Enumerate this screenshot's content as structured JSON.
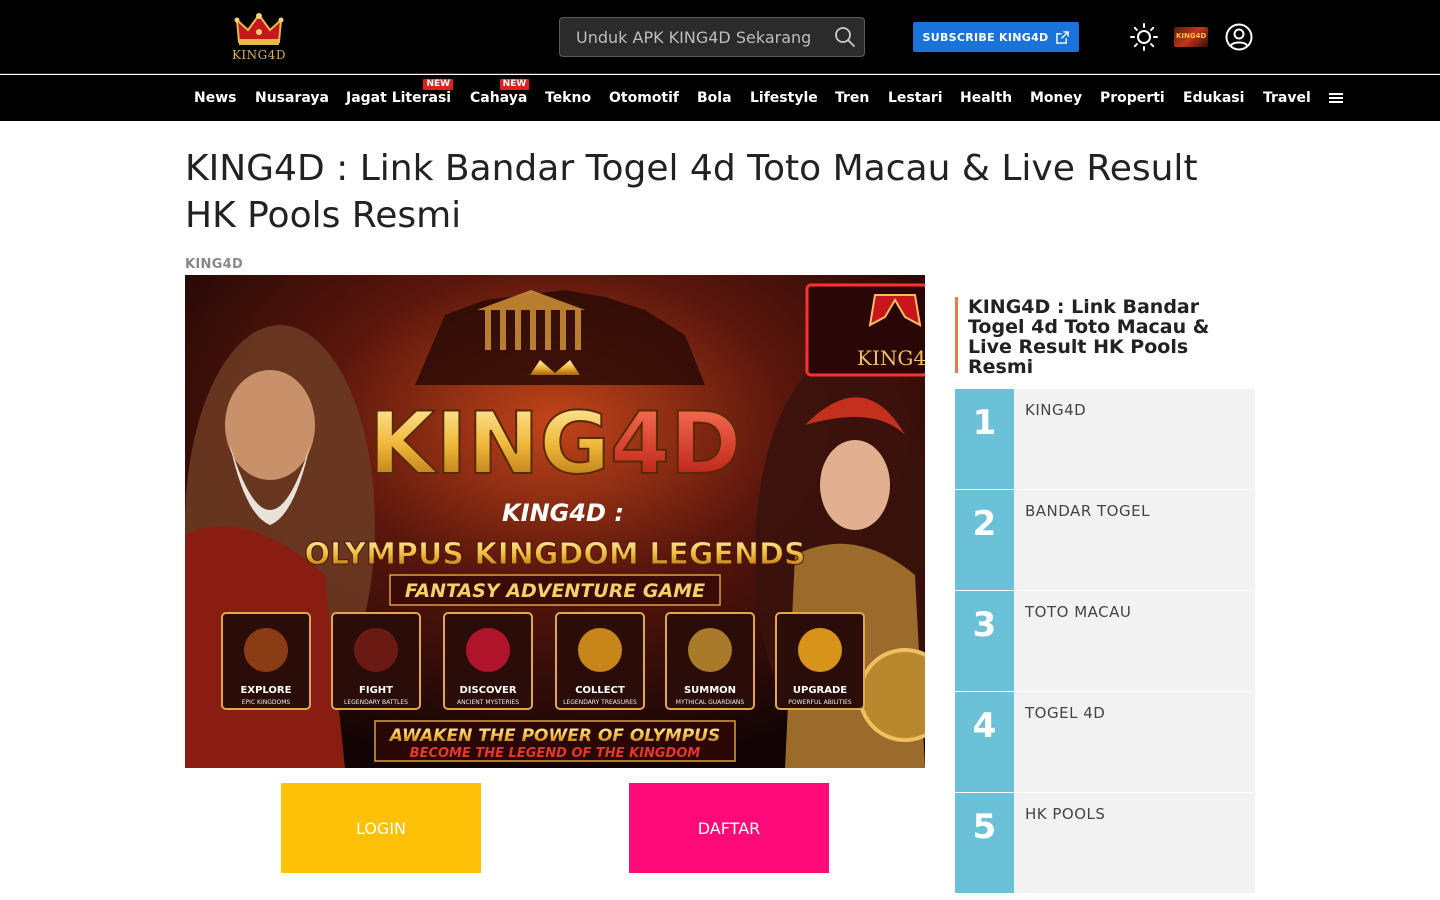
{
  "header": {
    "logo_text": "KING4D",
    "search_placeholder": "Unduk APK KING4D Sekarang",
    "subscribe_label": "SUBSCRIBE KING4D"
  },
  "nav": {
    "items": [
      {
        "label": "News"
      },
      {
        "label": "Nusaraya"
      },
      {
        "label": "Jagat Literasi",
        "badge": "NEW"
      },
      {
        "label": "Cahaya",
        "badge": "NEW"
      },
      {
        "label": "Tekno"
      },
      {
        "label": "Otomotif"
      },
      {
        "label": "Bola"
      },
      {
        "label": "Lifestyle"
      },
      {
        "label": "Tren"
      },
      {
        "label": "Lestari"
      },
      {
        "label": "Health"
      },
      {
        "label": "Money"
      },
      {
        "label": "Properti"
      },
      {
        "label": "Edukasi"
      },
      {
        "label": "Travel"
      }
    ]
  },
  "article": {
    "title": "KING4D : Link Bandar Togel 4d Toto Macau & Live Result HK Pools Resmi",
    "author": "KING4D",
    "banner": {
      "logo": "KING4D",
      "subtitle": "KING4D :",
      "headline": "OLYMPUS KINGDOM LEGENDS",
      "tagline": "FANTASY ADVENTURE GAME",
      "cards": [
        {
          "title": "EXPLORE",
          "sub": "EPIC KINGDOMS"
        },
        {
          "title": "FIGHT",
          "sub": "LEGENDARY BATTLES"
        },
        {
          "title": "DISCOVER",
          "sub": "ANCIENT MYSTERIES"
        },
        {
          "title": "COLLECT",
          "sub": "LEGENDARY TREASURES"
        },
        {
          "title": "SUMMON",
          "sub": "MYTHICAL GUARDIANS"
        },
        {
          "title": "UPGRADE",
          "sub": "POWERFUL ABILITIES"
        }
      ],
      "footer_line1": "AWAKEN THE POWER OF OLYMPUS",
      "footer_line2": "BECOME THE LEGEND OF THE KINGDOM"
    },
    "login_label": "LOGIN",
    "daftar_label": "DAFTAR"
  },
  "sidebar": {
    "heading": "KING4D : Link Bandar Togel 4d Toto Macau & Live Result HK Pools Resmi",
    "items": [
      {
        "num": "1",
        "label": "KING4D"
      },
      {
        "num": "2",
        "label": "BANDAR TOGEL"
      },
      {
        "num": "3",
        "label": "TOTO MACAU"
      },
      {
        "num": "4",
        "label": "TOGEL 4D"
      },
      {
        "num": "5",
        "label": "HK POOLS"
      }
    ]
  },
  "colors": {
    "topbar": "#000000",
    "subscribe": "#1a73d9",
    "login": "#ffc107",
    "daftar": "#ff0a78",
    "rank_number_bg": "#6ac1d8",
    "sidebar_accent": "#e87b4a"
  }
}
